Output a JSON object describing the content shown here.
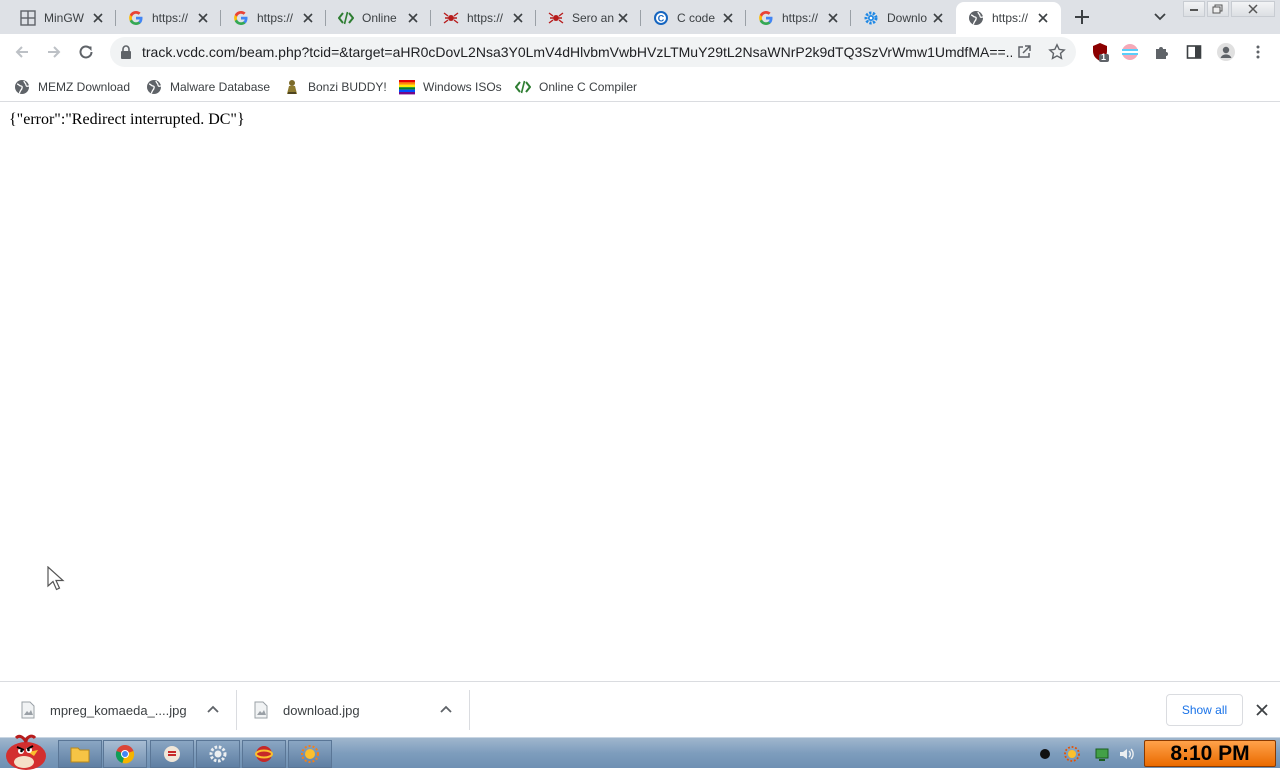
{
  "browser": {
    "tabs": [
      {
        "title": "MinGW",
        "icon": "grid-icon",
        "active": false
      },
      {
        "title": "https://",
        "icon": "google-icon",
        "active": false
      },
      {
        "title": "https://",
        "icon": "google-icon",
        "active": false
      },
      {
        "title": "Online",
        "icon": "code-icon",
        "active": false
      },
      {
        "title": "https://",
        "icon": "spider-icon",
        "active": false
      },
      {
        "title": "Sero an",
        "icon": "spider-icon",
        "active": false
      },
      {
        "title": "C code",
        "icon": "c-logo-icon",
        "active": false
      },
      {
        "title": "https://",
        "icon": "google-icon",
        "active": false
      },
      {
        "title": "Downlo",
        "icon": "gear-icon",
        "active": false
      },
      {
        "title": "https://",
        "icon": "globe-icon",
        "active": true
      }
    ],
    "url": "track.vcdc.com/beam.php?tcid=&target=aHR0cDovL2Nsa3Y0LmV4dHlvbmVwbHVzLTMuY29tL2NsaWNrP2k9dTQ3SzVrWmw1UmdfMA==...",
    "extension_badge": "1"
  },
  "bookmarks": [
    {
      "label": "MEMZ Download",
      "icon": "globe-icon"
    },
    {
      "label": "Malware Database",
      "icon": "globe-icon"
    },
    {
      "label": "Bonzi BUDDY!",
      "icon": "bonzi-icon"
    },
    {
      "label": "Windows ISOs",
      "icon": "windows-flag-icon"
    },
    {
      "label": "Online C Compiler",
      "icon": "code-icon"
    }
  ],
  "page": {
    "body_text": "{\"error\":\"Redirect interrupted. DC\"}"
  },
  "downloads": {
    "items": [
      {
        "filename": "mpreg_komaeda_....jpg"
      },
      {
        "filename": "download.jpg"
      }
    ],
    "show_all_label": "Show all"
  },
  "taskbar": {
    "clock": "8:10 PM"
  },
  "colors": {
    "tabstrip_bg": "#dee1e6",
    "omnibox_bg": "#f1f3f4",
    "link_blue": "#1a73e8",
    "clock_orange": "#f47f1b"
  }
}
